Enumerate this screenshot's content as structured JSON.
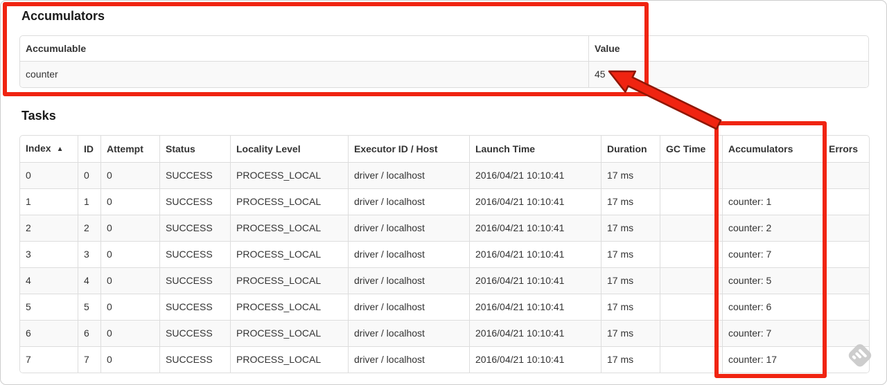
{
  "annotations": {
    "color": "#f02411",
    "arrow_outline": "#8f1604",
    "box_targets": [
      "accumulators-section",
      "tasks-accumulators-column"
    ],
    "arrow_points_to": "45"
  },
  "accumulators": {
    "heading": "Accumulators",
    "table": {
      "headers": [
        "Accumulable",
        "Value"
      ],
      "rows": [
        [
          "counter",
          "45"
        ]
      ]
    }
  },
  "tasks": {
    "heading": "Tasks",
    "table": {
      "headers": [
        "Index",
        "ID",
        "Attempt",
        "Status",
        "Locality Level",
        "Executor ID / Host",
        "Launch Time",
        "Duration",
        "GC Time",
        "Accumulators",
        "Errors"
      ],
      "sort": {
        "column": 0,
        "icon": "▲",
        "direction": "asc"
      },
      "rows": [
        [
          "0",
          "0",
          "0",
          "SUCCESS",
          "PROCESS_LOCAL",
          "driver / localhost",
          "2016/04/21 10:10:41",
          "17 ms",
          "",
          "",
          ""
        ],
        [
          "1",
          "1",
          "0",
          "SUCCESS",
          "PROCESS_LOCAL",
          "driver / localhost",
          "2016/04/21 10:10:41",
          "17 ms",
          "",
          "counter: 1",
          ""
        ],
        [
          "2",
          "2",
          "0",
          "SUCCESS",
          "PROCESS_LOCAL",
          "driver / localhost",
          "2016/04/21 10:10:41",
          "17 ms",
          "",
          "counter: 2",
          ""
        ],
        [
          "3",
          "3",
          "0",
          "SUCCESS",
          "PROCESS_LOCAL",
          "driver / localhost",
          "2016/04/21 10:10:41",
          "17 ms",
          "",
          "counter: 7",
          ""
        ],
        [
          "4",
          "4",
          "0",
          "SUCCESS",
          "PROCESS_LOCAL",
          "driver / localhost",
          "2016/04/21 10:10:41",
          "17 ms",
          "",
          "counter: 5",
          ""
        ],
        [
          "5",
          "5",
          "0",
          "SUCCESS",
          "PROCESS_LOCAL",
          "driver / localhost",
          "2016/04/21 10:10:41",
          "17 ms",
          "",
          "counter: 6",
          ""
        ],
        [
          "6",
          "6",
          "0",
          "SUCCESS",
          "PROCESS_LOCAL",
          "driver / localhost",
          "2016/04/21 10:10:41",
          "17 ms",
          "",
          "counter: 7",
          ""
        ],
        [
          "7",
          "7",
          "0",
          "SUCCESS",
          "PROCESS_LOCAL",
          "driver / localhost",
          "2016/04/21 10:10:41",
          "17 ms",
          "",
          "counter: 17",
          ""
        ]
      ]
    }
  },
  "watermark": {
    "icon_name": "feedly-watermark-icon"
  }
}
